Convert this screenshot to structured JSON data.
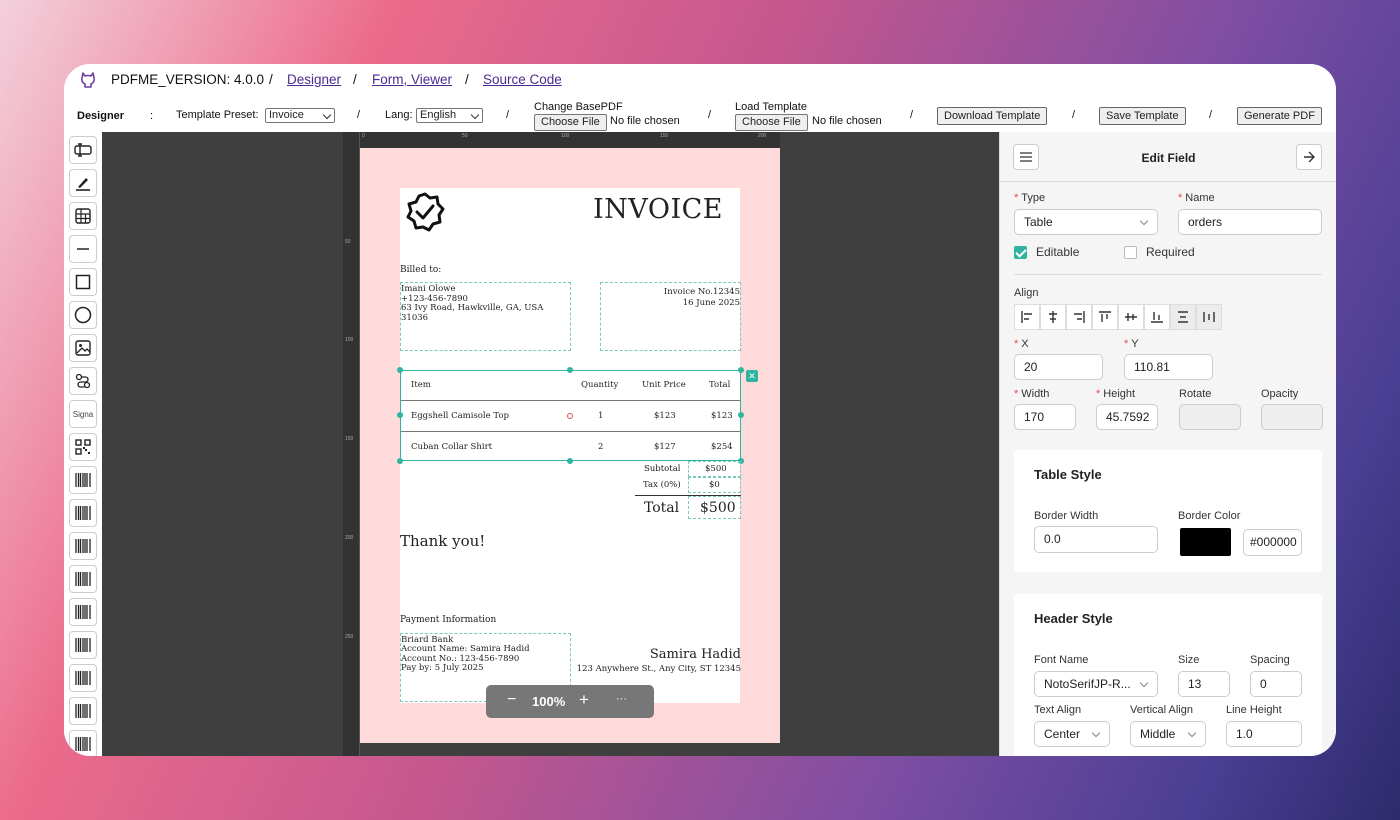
{
  "header": {
    "version": "PDFME_VERSION: 4.0.0",
    "links": [
      "Designer",
      "Form, Viewer",
      "Source Code"
    ],
    "slash": "/"
  },
  "toolbar": {
    "mode": "Designer",
    "colon": ":",
    "template_preset_label": "Template Preset:",
    "template_preset_value": "Invoice",
    "lang_label": "Lang:",
    "lang_value": "English",
    "change_basepdf_label": "Change BasePDF",
    "load_template_label": "Load Template",
    "choose_file": "Choose File",
    "no_file": "No file chosen",
    "download_template": "Download Template",
    "save_template": "Save Template",
    "generate_pdf": "Generate PDF"
  },
  "sidebar": {
    "signature_label": "Signa",
    "tools": [
      "text-icon",
      "pen-icon",
      "table-icon",
      "line-icon",
      "rectangle-icon",
      "ellipse-icon",
      "image-icon",
      "svg-icon",
      "signature",
      "qrcode-icon",
      "barcode-icon",
      "barcode-icon",
      "barcode-icon",
      "barcode-icon",
      "barcode-icon",
      "barcode-icon",
      "barcode-icon",
      "barcode-icon",
      "barcode-icon"
    ]
  },
  "rulers": {
    "top": [
      "0",
      "50",
      "100",
      "150",
      "200"
    ],
    "left": [
      "50",
      "100",
      "150",
      "200",
      "250"
    ]
  },
  "invoice": {
    "title": "INVOICE",
    "billed_to_label": "Billed to:",
    "billed_lines": [
      "Imani Olowe",
      "+123-456-7890",
      "63 Ivy Road, Hawkville, GA, USA 31036"
    ],
    "invoice_no": "Invoice No.12345",
    "invoice_date": "16 June 2025",
    "table_headers": [
      "Item",
      "Quantity",
      "Unit Price",
      "Total"
    ],
    "rows": [
      {
        "item": "Eggshell Camisole Top",
        "qty": "1",
        "price": "$123",
        "total": "$123"
      },
      {
        "item": "Cuban Collar Shirt",
        "qty": "2",
        "price": "$127",
        "total": "$254"
      }
    ],
    "subtotal_label": "Subtotal",
    "subtotal_value": "$500",
    "tax_label": "Tax (0%)",
    "tax_value": "$0",
    "total_label": "Total",
    "total_value": "$500",
    "thanks": "Thank you!",
    "payment_label": "Payment Information",
    "payment_lines": [
      "Briard Bank",
      "Account Name: Samira Hadid",
      "Account No.: 123-456-7890",
      "Pay by: 5 July 2025"
    ],
    "signer_name": "Samira Hadid",
    "signer_address": "123 Anywhere St., Any City, ST 12345"
  },
  "zoom": {
    "minus": "−",
    "value": "100%",
    "plus": "+",
    "more": "···"
  },
  "panel": {
    "title": "Edit Field",
    "type_label": "Type",
    "type_value": "Table",
    "name_label": "Name",
    "name_value": "orders",
    "editable_label": "Editable",
    "required_label": "Required",
    "editable": true,
    "required": false,
    "align_label": "Align",
    "x_label": "X",
    "x_value": "20",
    "y_label": "Y",
    "y_value": "110.81",
    "width_label": "Width",
    "width_value": "170",
    "height_label": "Height",
    "height_value": "45.7592",
    "rotate_label": "Rotate",
    "opacity_label": "Opacity",
    "table_style": {
      "title": "Table Style",
      "border_width_label": "Border Width",
      "border_width_value": "0.0",
      "border_color_label": "Border Color",
      "border_color_value": "#000000",
      "border_color_swatch": "#000000"
    },
    "header_style": {
      "title": "Header Style",
      "font_name_label": "Font Name",
      "font_name_value": "NotoSerifJP-R...",
      "size_label": "Size",
      "size_value": "13",
      "spacing_label": "Spacing",
      "spacing_value": "0",
      "text_align_label": "Text Align",
      "text_align_value": "Center",
      "vertical_align_label": "Vertical Align",
      "vertical_align_value": "Middle",
      "line_height_label": "Line Height",
      "line_height_value": "1.0"
    }
  },
  "colors": {
    "accent": "#2fb59f",
    "link": "#4b2a8f",
    "padding": "#ffb3b3",
    "canvas": "#3f3f3f"
  }
}
